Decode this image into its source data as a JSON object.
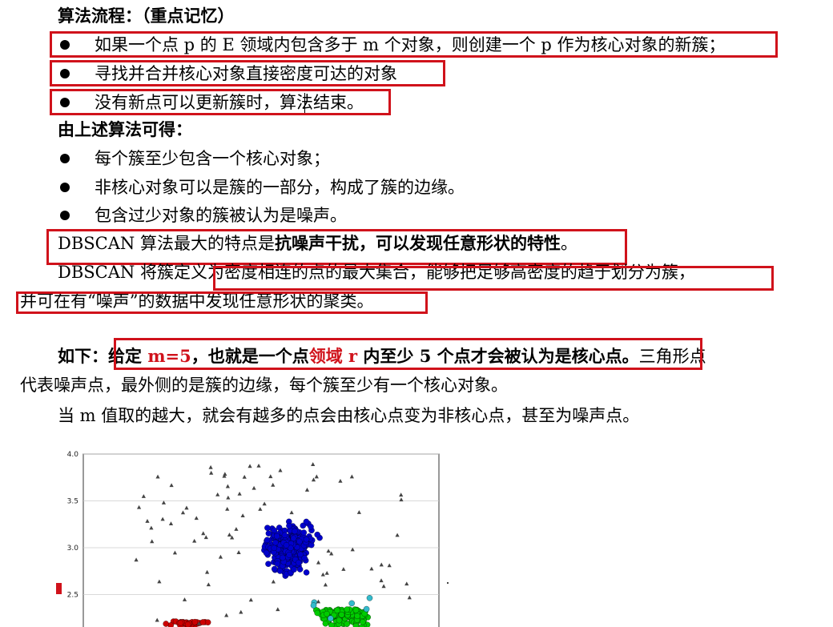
{
  "doc": {
    "section_title": "算法流程：（重点记忆）",
    "steps": [
      "如果一个点 p 的 E 领域内包含多于 m 个对象，则创建一个 p 作为核心对象的新簇；",
      "寻找并合并核心对象直接密度可达的对象",
      "没有新点可以更新簇时，算法结束。"
    ],
    "conclusion_title": "由上述算法可得：",
    "conclusions": [
      "每个簇至少包含一个核心对象；",
      "非核心对象可以是簇的一部分，构成了簇的边缘。",
      "包含过少对象的簇被认为是噪声。"
    ],
    "feature": {
      "prefix": "DBSCAN 算法最大的特点是",
      "bold": "抗噪声干扰，可以发现任意形状的特性",
      "suffix": "。"
    },
    "definition_line1": "DBSCAN 将簇定义为密度相连的点的最大集合，能够把足够高密度的趋于划分为簇，",
    "definition_line2": "并可在有“噪声”的数据中发现任意形状的聚类。",
    "example": {
      "lead": "如下：",
      "given": "给定 ",
      "m_value": "m=5",
      "also": "，也就是一个点",
      "field": "领域 r",
      "rest": " 内至少 5 个点才会被认为是核心点。",
      "tail": "三角形点",
      "line2": "代表噪声点，最外侧的是簇的边缘，每个簇至少有一个核心对象。"
    },
    "note": "当 m 值取的越大，就会有越多的点会由核心点变为非核心点，甚至为噪声点。"
  },
  "chart_data": {
    "type": "scatter",
    "ylim": [
      2.0,
      4.0
    ],
    "yticks": [
      "4.0",
      "3.5",
      "3.0",
      "2.5"
    ],
    "series": [
      {
        "color": "#0000cc",
        "marker": "circle",
        "center": [
          0,
          3.0
        ]
      },
      {
        "color": "#00cc00",
        "marker": "circle",
        "center": [
          1,
          2.3
        ]
      },
      {
        "color": "#cc0000",
        "marker": "circle",
        "center": [
          -1,
          2.1
        ]
      },
      {
        "color": "#333333",
        "marker": "triangle"
      }
    ]
  },
  "colors": {
    "highlight": "#d0121b",
    "text": "#000000"
  }
}
